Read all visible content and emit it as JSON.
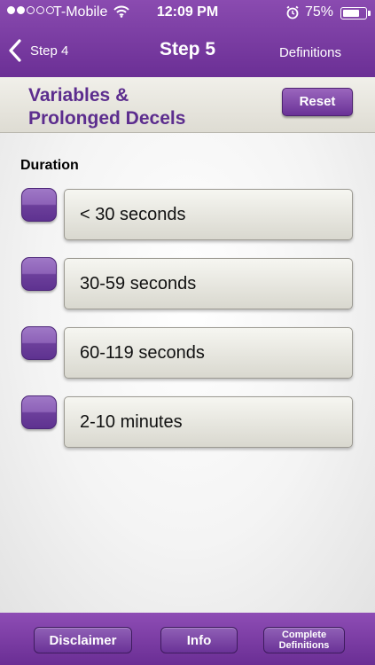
{
  "status_bar": {
    "carrier": "T-Mobile",
    "time": "12:09 PM",
    "battery_percent": "75%",
    "battery_level": 0.75,
    "signal_bars_full": 2,
    "signal_bars_total": 5
  },
  "nav": {
    "back_label": "Step 4",
    "title": "Step 5",
    "right_link": "Definitions"
  },
  "section": {
    "title_line1": "Variables &",
    "title_line2": "Prolonged Decels",
    "reset_label": "Reset"
  },
  "duration": {
    "label": "Duration",
    "options": [
      {
        "label": "< 30 seconds"
      },
      {
        "label": "30-59 seconds"
      },
      {
        "label": "60-119 seconds"
      },
      {
        "label": "2-10 minutes"
      }
    ]
  },
  "bottom_bar": {
    "disclaimer": "Disclaimer",
    "info": "Info",
    "complete_line1": "Complete",
    "complete_line2": "Definitions"
  },
  "colors": {
    "brand_purple": "#6b2f95",
    "title_purple": "#5c2d8e",
    "header_band": "#e8e6de"
  },
  "icons": [
    "signal-dots-icon",
    "wifi-icon",
    "alarm-clock-icon",
    "battery-icon",
    "chevron-left-icon"
  ]
}
